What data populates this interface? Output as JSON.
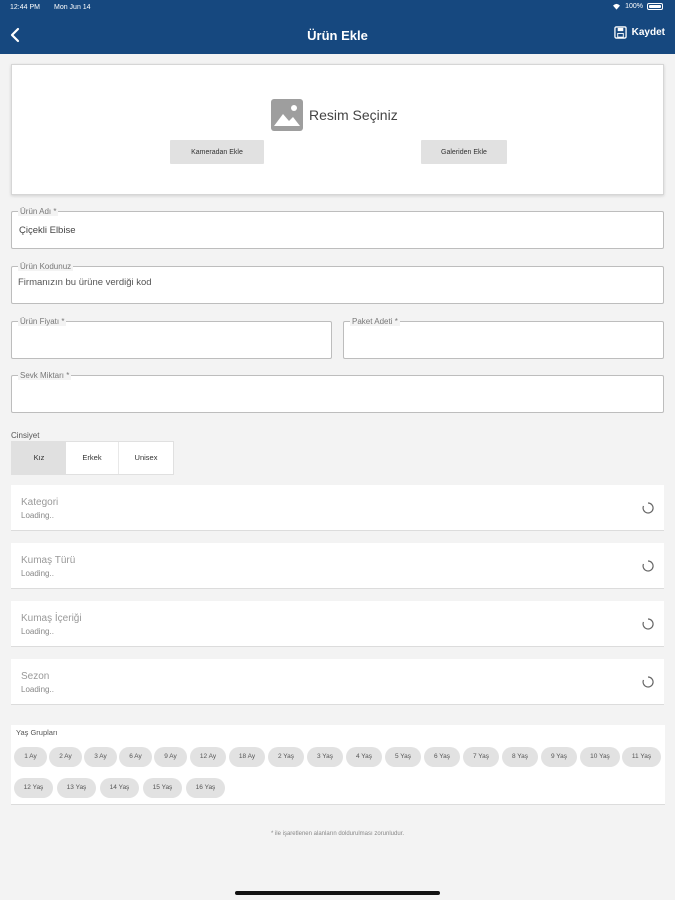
{
  "status": {
    "time": "12:44 PM",
    "date": "Mon Jun 14",
    "battery": "100%"
  },
  "nav": {
    "title": "Ürün Ekle",
    "save_label": "Kaydet"
  },
  "image_picker": {
    "title": "Resim Seçiniz",
    "camera_button": "Kameradan Ekle",
    "gallery_button": "Galeriden Ekle"
  },
  "fields": {
    "product_name": {
      "label": "Ürün Adı *",
      "value": "Çiçekli Elbise"
    },
    "product_code": {
      "label": "Ürün Kodunuz",
      "placeholder": "Firmanızın bu ürüne verdiği kod"
    },
    "price": {
      "label": "Ürün Fiyatı *",
      "value": ""
    },
    "package_count": {
      "label": "Paket Adeti *",
      "value": ""
    },
    "ship_amount": {
      "label": "Sevk Miktarı *",
      "value": ""
    }
  },
  "gender": {
    "label": "Cinsiyet",
    "options": [
      "Kız",
      "Erkek",
      "Unisex"
    ],
    "selected": "Kız"
  },
  "selects": [
    {
      "title": "Kategori",
      "status": "Loading.."
    },
    {
      "title": "Kumaş Türü",
      "status": "Loading.."
    },
    {
      "title": "Kumaş İçeriği",
      "status": "Loading.."
    },
    {
      "title": "Sezon",
      "status": "Loading.."
    }
  ],
  "age_groups": {
    "title": "Yaş Grupları",
    "chips": [
      "1 Ay",
      "2 Ay",
      "3 Ay",
      "6 Ay",
      "9 Ay",
      "12 Ay",
      "18 Ay",
      "2 Yaş",
      "3 Yaş",
      "4 Yaş",
      "5 Yaş",
      "6 Yaş",
      "7 Yaş",
      "8 Yaş",
      "9 Yaş",
      "10 Yaş",
      "11 Yaş",
      "12 Yaş",
      "13 Yaş",
      "14 Yaş",
      "15 Yaş",
      "16 Yaş"
    ]
  },
  "footnote": "* ile işaretlenen alanların doldurulması zorunludur.",
  "colors": {
    "nav_bg": "#16487f",
    "chip_bg": "#e2e2e2",
    "page_bg": "#f3f3f3"
  },
  "icons": {
    "back": "chevron-left-icon",
    "save": "save-icon",
    "image": "image-icon",
    "spinner": "spinner-icon"
  }
}
